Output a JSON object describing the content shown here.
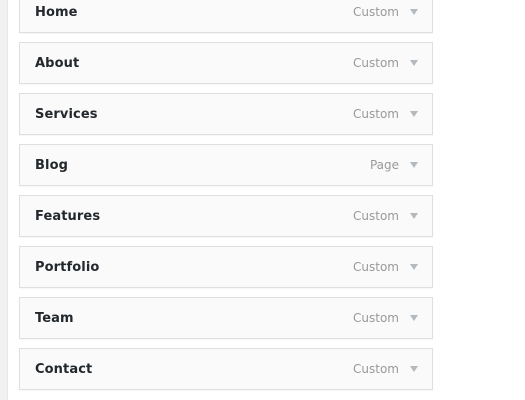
{
  "menu": {
    "items": [
      {
        "title": "Home",
        "type": "Custom"
      },
      {
        "title": "About",
        "type": "Custom"
      },
      {
        "title": "Services",
        "type": "Custom"
      },
      {
        "title": "Blog",
        "type": "Page"
      },
      {
        "title": "Features",
        "type": "Custom"
      },
      {
        "title": "Portfolio",
        "type": "Custom"
      },
      {
        "title": "Team",
        "type": "Custom"
      },
      {
        "title": "Contact",
        "type": "Custom"
      }
    ],
    "toggle_icon": "triangle-down-icon"
  },
  "colors": {
    "item_background": "#fafafa",
    "item_border": "#dfdfdf",
    "title_text": "#23282d",
    "type_text": "#999999",
    "toggle_arrow": "#b4b9be"
  }
}
